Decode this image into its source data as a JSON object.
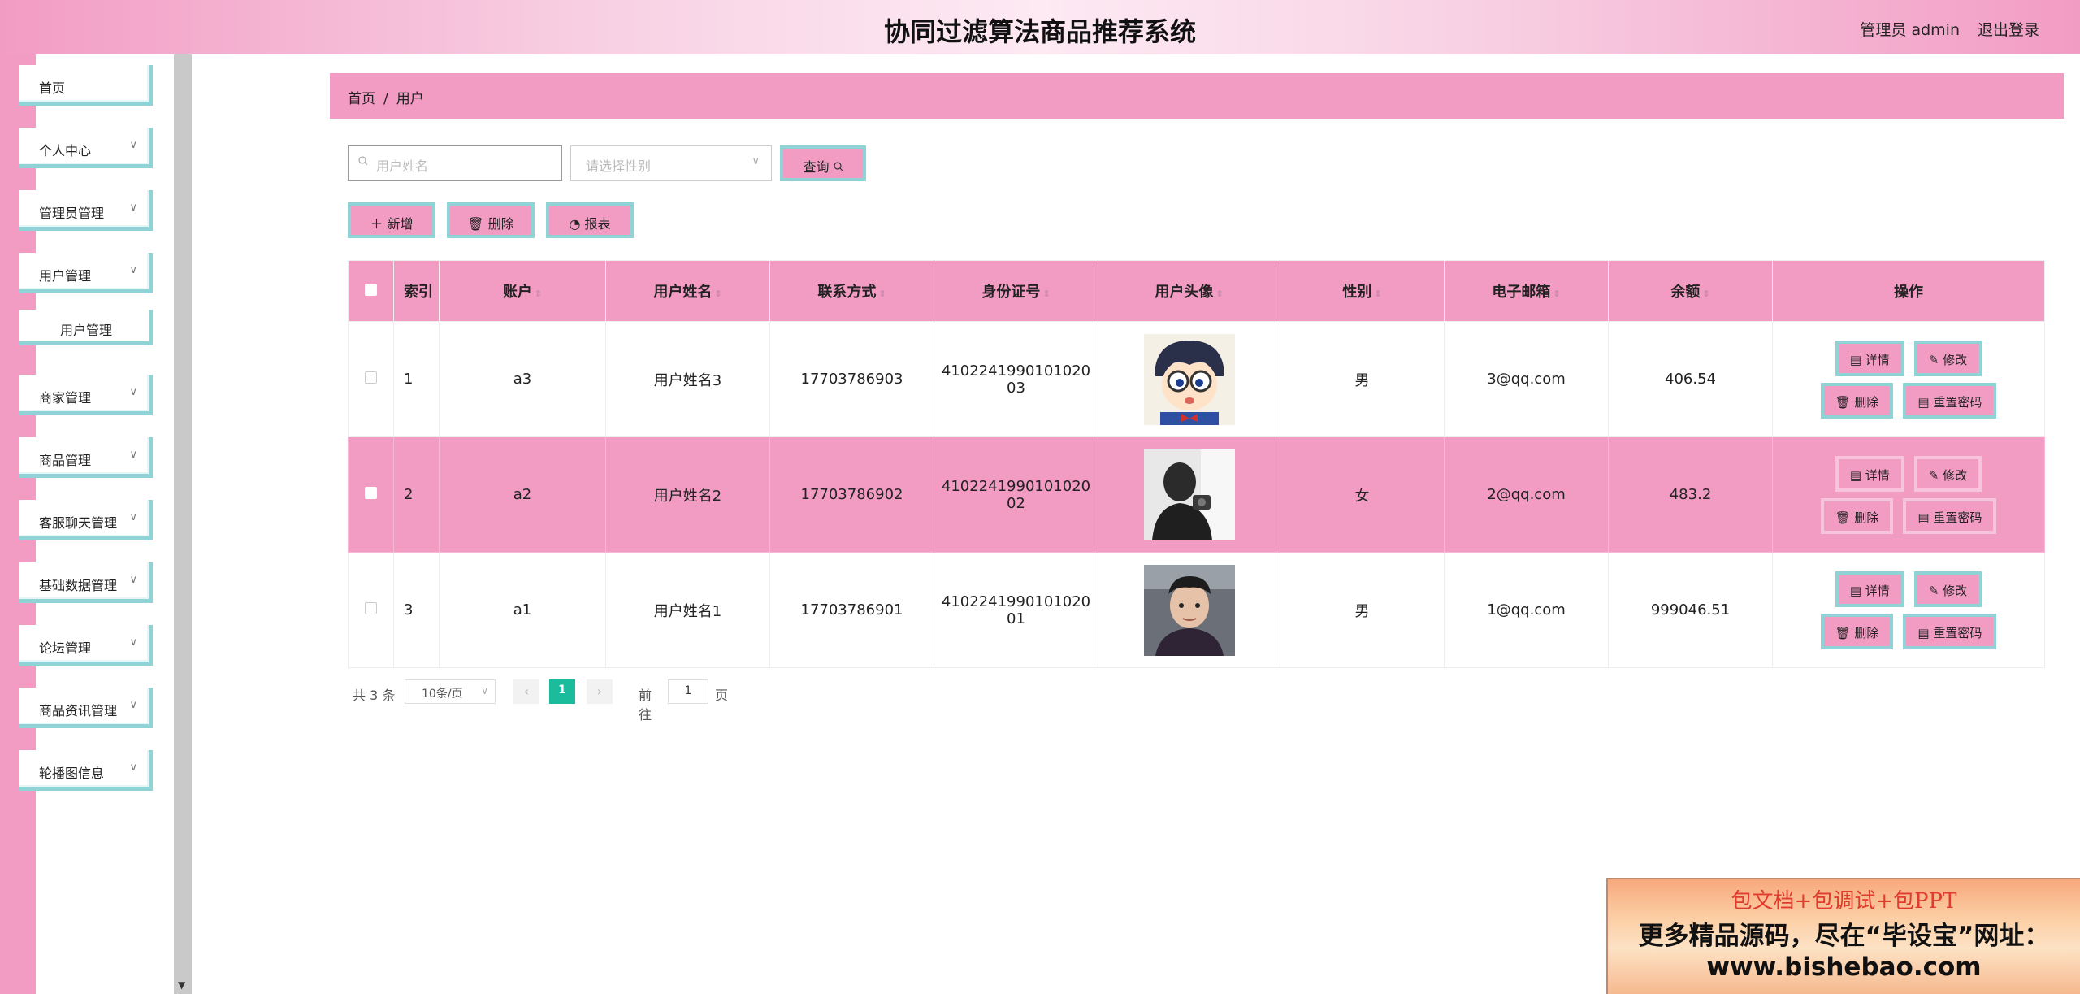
{
  "header": {
    "title": "协同过滤算法商品推荐系统",
    "user": "管理员 admin",
    "logout": "退出登录"
  },
  "sidebar": {
    "items": [
      {
        "label": "首页",
        "has_children": false
      },
      {
        "label": "个人中心",
        "has_children": true
      },
      {
        "label": "管理员管理",
        "has_children": true
      },
      {
        "label": "用户管理",
        "has_children": true
      },
      {
        "label": "商家管理",
        "has_children": true
      },
      {
        "label": "商品管理",
        "has_children": true
      },
      {
        "label": "客服聊天管理",
        "has_children": true
      },
      {
        "label": "基础数据管理",
        "has_children": true
      },
      {
        "label": "论坛管理",
        "has_children": true
      },
      {
        "label": "商品资讯管理",
        "has_children": true
      },
      {
        "label": "轮播图信息",
        "has_children": true
      }
    ],
    "sub_item": "用户管理"
  },
  "breadcrumb": {
    "home": "首页",
    "sep": "/",
    "current": "用户"
  },
  "search": {
    "name_placeholder": "用户姓名",
    "gender_placeholder": "请选择性别",
    "query_label": "查询"
  },
  "toolbar": {
    "add_label": "新增",
    "delete_label": "删除",
    "report_label": "报表"
  },
  "table": {
    "columns": [
      "索引",
      "账户",
      "用户姓名",
      "联系方式",
      "身份证号",
      "用户头像",
      "性别",
      "电子邮箱",
      "余额",
      "操作"
    ],
    "rows": [
      {
        "index": "1",
        "account": "a3",
        "name": "用户姓名3",
        "phone": "17703786903",
        "id_line1": "4102241990101020",
        "id_line2": "03",
        "gender": "男",
        "email": "3@qq.com",
        "balance": "406.54",
        "avatar": "cartoon-boy"
      },
      {
        "index": "2",
        "account": "a2",
        "name": "用户姓名2",
        "phone": "17703786902",
        "id_line1": "4102241990101020",
        "id_line2": "02",
        "gender": "女",
        "email": "2@qq.com",
        "balance": "483.2",
        "avatar": "silhouette"
      },
      {
        "index": "3",
        "account": "a1",
        "name": "用户姓名1",
        "phone": "17703786901",
        "id_line1": "4102241990101020",
        "id_line2": "01",
        "gender": "男",
        "email": "1@qq.com",
        "balance": "999046.51",
        "avatar": "young-man"
      }
    ],
    "actions": {
      "detail": "详情",
      "edit": "修改",
      "delete": "删除",
      "reset_pwd": "重置密码"
    }
  },
  "pager": {
    "total": "共 3 条",
    "page_size": "10条/页",
    "current_page": "1",
    "goto_prefix": "前往",
    "goto_value": "1",
    "goto_suffix": "页"
  },
  "ad": {
    "line1": "包文档+包调试+包PPT",
    "line2": "更多精品源码，尽在“毕设宝”网址：",
    "line3": "www.bishebao.com"
  },
  "colors": {
    "accent_pink": "#f29cc4",
    "accent_teal": "#8fd3d6",
    "page_active": "#1abc9c"
  }
}
